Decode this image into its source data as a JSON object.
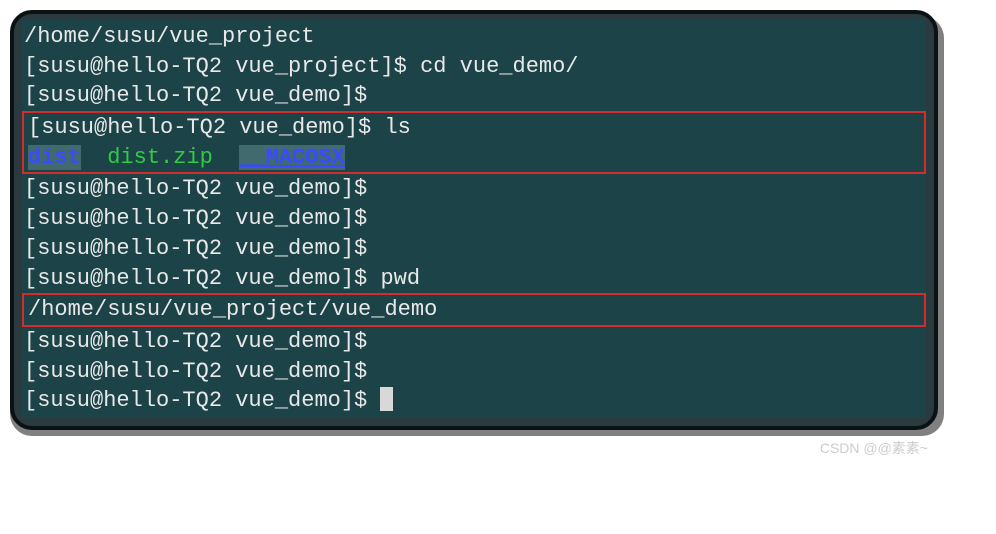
{
  "terminal": {
    "lines": {
      "line1": "/home/susu/vue_project",
      "line2_prompt": "[susu@hello-TQ2 vue_project]$ ",
      "line2_cmd": "cd vue_demo/",
      "line3_prompt": "[susu@hello-TQ2 vue_demo]$ ",
      "line4_prompt": "[susu@hello-TQ2 vue_demo]$ ",
      "line4_cmd": "ls",
      "line5_dist": "dist",
      "line5_distzip": "dist.zip",
      "line5_macosx": "__MACOSX",
      "line6_prompt": "[susu@hello-TQ2 vue_demo]$ ",
      "line7_prompt": "[susu@hello-TQ2 vue_demo]$ ",
      "line8_prompt": "[susu@hello-TQ2 vue_demo]$ ",
      "line9_prompt": "[susu@hello-TQ2 vue_demo]$ ",
      "line9_cmd": "pwd",
      "line10": "/home/susu/vue_project/vue_demo",
      "line11_prompt": "[susu@hello-TQ2 vue_demo]$ ",
      "line12_prompt": "[susu@hello-TQ2 vue_demo]$ ",
      "line13_prompt": "[susu@hello-TQ2 vue_demo]$ "
    }
  },
  "watermark": "CSDN @@素素~"
}
